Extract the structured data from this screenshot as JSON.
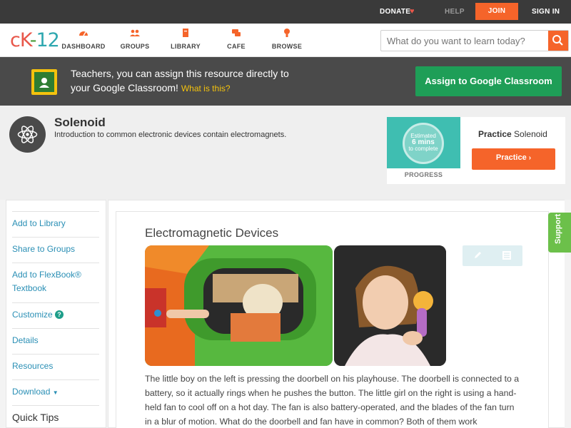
{
  "topbar": {
    "donate": "DONATE",
    "heart_icon": "heart-icon",
    "help": "HELP",
    "join": "JOIN",
    "signin": "SIGN IN"
  },
  "nav": {
    "logo": {
      "ck": "cK",
      "dash": "-",
      "twelve": "12"
    },
    "items": [
      {
        "label": "DASHBOARD",
        "icon": "dashboard-icon"
      },
      {
        "label": "GROUPS",
        "icon": "groups-icon"
      },
      {
        "label": "LIBRARY",
        "icon": "library-icon"
      },
      {
        "label": "CAFE",
        "icon": "cafe-icon"
      },
      {
        "label": "BROWSE",
        "icon": "browse-icon"
      }
    ],
    "search_placeholder": "What do you want to learn today?"
  },
  "classroom_banner": {
    "line1": "Teachers, you can assign this resource directly to",
    "line2": "your Google Classroom!",
    "what_link": "What is this?",
    "button": "Assign to Google Classroom"
  },
  "header": {
    "title": "Solenoid",
    "subtitle": "Introduction to common electronic devices contain electromagnets.",
    "progress": {
      "estimated": "Estimated",
      "mins": "6 mins",
      "complete": "to complete",
      "label": "PROGRESS"
    },
    "practice": {
      "title_bold": "Practice",
      "title_rest": "Solenoid",
      "button": "Practice"
    }
  },
  "sidebar": {
    "items": [
      {
        "label": "Add to Library"
      },
      {
        "label": "Share to Groups"
      },
      {
        "label": "Add to FlexBook® Textbook"
      },
      {
        "label": "Customize"
      },
      {
        "label": "Details"
      },
      {
        "label": "Resources"
      },
      {
        "label": "Download"
      }
    ],
    "quick_tips": "Quick Tips"
  },
  "content": {
    "section_title": "Electromagnetic Devices",
    "paragraph": "The little boy on the left is pressing the doorbell on his playhouse. The doorbell is connected to a battery, so it actually rings when he pushes the button. The little girl on the right is using a hand-held fan to cool off on a hot day. The fan is also battery-operated, and the blades of the fan turn in a blur of motion. What do the doorbell and fan have in common? Both of them work"
  },
  "support": "Support",
  "colors": {
    "accent_orange": "#f5642a",
    "google_green": "#1e9e57",
    "link_blue": "#2a8fb5",
    "support_green": "#6cc04a"
  }
}
